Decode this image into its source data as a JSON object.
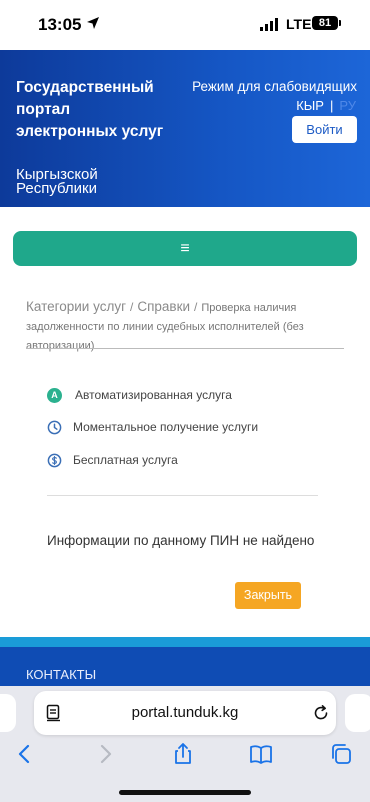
{
  "status": {
    "time": "13:05",
    "network": "LTE",
    "battery": "81"
  },
  "header": {
    "title": "Государственный портал электронных услуг",
    "subtitle": "Кыргызской Республики",
    "vision_mode": "Режим для слабовидящих",
    "lang_ky": "КЫР",
    "lang_sep": "|",
    "lang_ru": "РУ",
    "login": "Войти"
  },
  "menu": {
    "icon": "≡"
  },
  "breadcrumb": {
    "items": [
      "Категории услуг",
      "Справки"
    ],
    "separator": "/",
    "current": "Проверка наличия задолженности по линии судебных исполнителей (без авторизации)"
  },
  "features": [
    {
      "icon": "automated-icon",
      "badge": "A",
      "label": "Автоматизированная услуга"
    },
    {
      "icon": "clock-icon",
      "label": "Моментальное получение услуги"
    },
    {
      "icon": "coin-icon",
      "label": "Бесплатная услуга"
    }
  ],
  "message": "Информации по данному ПИН не найдено",
  "close_button": "Закрыть",
  "footer": {
    "contacts": "КОНТАКТЫ"
  },
  "browser": {
    "url": "portal.tunduk.kg"
  },
  "colors": {
    "header": "#1556c4",
    "teal": "#1fa88b",
    "orange": "#f5a623",
    "footer": "#0f4cb4"
  }
}
